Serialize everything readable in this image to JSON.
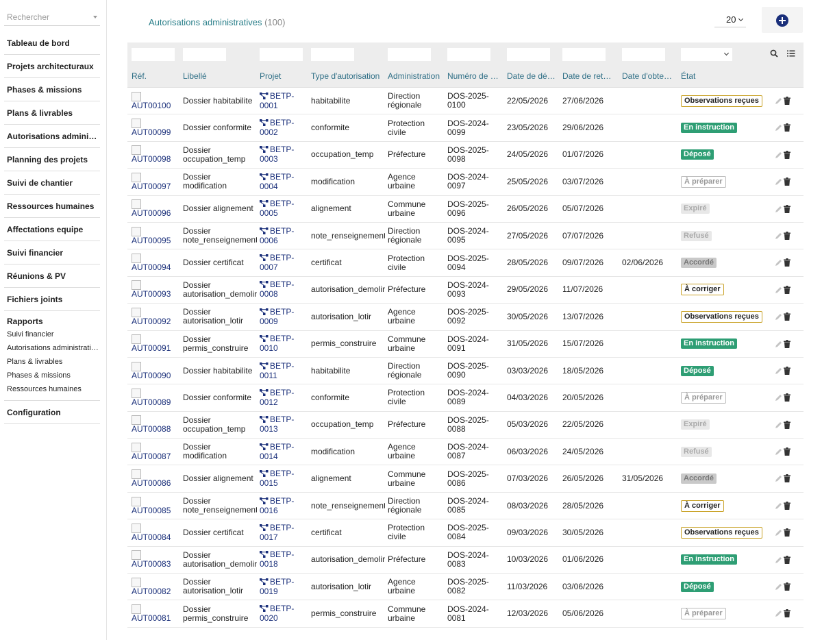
{
  "sidebar": {
    "search_placeholder": "Rechercher",
    "items": [
      {
        "label": "Tableau de bord"
      },
      {
        "label": "Projets architecturaux"
      },
      {
        "label": "Phases & missions"
      },
      {
        "label": "Plans & livrables"
      },
      {
        "label": "Autorisations administratives"
      },
      {
        "label": "Planning des projets"
      },
      {
        "label": "Suivi de chantier"
      },
      {
        "label": "Ressources humaines"
      },
      {
        "label": "Affectations equipe"
      },
      {
        "label": "Suivi financier"
      },
      {
        "label": "Réunions & PV"
      },
      {
        "label": "Fichiers joints"
      }
    ],
    "reports": {
      "title": "Rapports",
      "items": [
        "Suivi financier",
        "Autorisations administratives",
        "Plans & livrables",
        "Phases & missions",
        "Ressources humaines"
      ]
    },
    "config": "Configuration"
  },
  "header": {
    "title": "Autorisations administratives",
    "count": "(100)",
    "page_size": "20"
  },
  "table": {
    "columns": [
      "Réf.",
      "Libellé",
      "Projet",
      "Type d'autorisation",
      "Administration",
      "Numéro de dossier",
      "Date de dépôt",
      "Date de retour prévue",
      "Date d'obtention",
      "État"
    ],
    "rows": [
      {
        "ref": "AUT00100",
        "libelle": "Dossier habitabilite",
        "projet": [
          "BETP-",
          "0001"
        ],
        "type": "habitabilite",
        "admin": [
          "Direction",
          "régionale"
        ],
        "numero": [
          "DOS-2025-",
          "0100"
        ],
        "depot": "22/05/2026",
        "retour": "27/06/2026",
        "obtention": "",
        "etat": "Observations reçues",
        "etat_kind": "observations"
      },
      {
        "ref": "AUT00099",
        "libelle": "Dossier conformite",
        "projet": [
          "BETP-",
          "0002"
        ],
        "type": "conformite",
        "admin": [
          "Protection",
          "civile"
        ],
        "numero": [
          "DOS-2024-",
          "0099"
        ],
        "depot": "23/05/2026",
        "retour": "29/06/2026",
        "obtention": "",
        "etat": "En instruction",
        "etat_kind": "instruction"
      },
      {
        "ref": "AUT00098",
        "libelle": "Dossier occupation_temp",
        "projet": [
          "BETP-",
          "0003"
        ],
        "type": "occupation_temp",
        "admin": [
          "Préfecture",
          ""
        ],
        "numero": [
          "DOS-2025-",
          "0098"
        ],
        "depot": "24/05/2026",
        "retour": "01/07/2026",
        "obtention": "",
        "etat": "Déposé",
        "etat_kind": "depose"
      },
      {
        "ref": "AUT00097",
        "libelle": "Dossier modification",
        "projet": [
          "BETP-",
          "0004"
        ],
        "type": "modification",
        "admin": [
          "Agence",
          "urbaine"
        ],
        "numero": [
          "DOS-2024-",
          "0097"
        ],
        "depot": "25/05/2026",
        "retour": "03/07/2026",
        "obtention": "",
        "etat": "À préparer",
        "etat_kind": "preparer"
      },
      {
        "ref": "AUT00096",
        "libelle": "Dossier alignement",
        "projet": [
          "BETP-",
          "0005"
        ],
        "type": "alignement",
        "admin": [
          "Commune",
          "urbaine"
        ],
        "numero": [
          "DOS-2025-",
          "0096"
        ],
        "depot": "26/05/2026",
        "retour": "05/07/2026",
        "obtention": "",
        "etat": "Expiré",
        "etat_kind": "expire"
      },
      {
        "ref": "AUT00095",
        "libelle": "Dossier note_renseignement",
        "projet": [
          "BETP-",
          "0006"
        ],
        "type": "note_renseignement",
        "admin": [
          "Direction",
          "régionale"
        ],
        "numero": [
          "DOS-2024-",
          "0095"
        ],
        "depot": "27/05/2026",
        "retour": "07/07/2026",
        "obtention": "",
        "etat": "Refusé",
        "etat_kind": "refuse"
      },
      {
        "ref": "AUT00094",
        "libelle": "Dossier certificat",
        "projet": [
          "BETP-",
          "0007"
        ],
        "type": "certificat",
        "admin": [
          "Protection",
          "civile"
        ],
        "numero": [
          "DOS-2025-",
          "0094"
        ],
        "depot": "28/05/2026",
        "retour": "09/07/2026",
        "obtention": "02/06/2026",
        "etat": "Accordé",
        "etat_kind": "accorde"
      },
      {
        "ref": "AUT00093",
        "libelle": "Dossier autorisation_demolir",
        "projet": [
          "BETP-",
          "0008"
        ],
        "type": "autorisation_demolir",
        "admin": [
          "Préfecture",
          ""
        ],
        "numero": [
          "DOS-2024-",
          "0093"
        ],
        "depot": "29/05/2026",
        "retour": "11/07/2026",
        "obtention": "",
        "etat": "À corriger",
        "etat_kind": "corriger"
      },
      {
        "ref": "AUT00092",
        "libelle": "Dossier autorisation_lotir",
        "projet": [
          "BETP-",
          "0009"
        ],
        "type": "autorisation_lotir",
        "admin": [
          "Agence",
          "urbaine"
        ],
        "numero": [
          "DOS-2025-",
          "0092"
        ],
        "depot": "30/05/2026",
        "retour": "13/07/2026",
        "obtention": "",
        "etat": "Observations reçues",
        "etat_kind": "observations"
      },
      {
        "ref": "AUT00091",
        "libelle": "Dossier permis_construire",
        "projet": [
          "BETP-",
          "0010"
        ],
        "type": "permis_construire",
        "admin": [
          "Commune",
          "urbaine"
        ],
        "numero": [
          "DOS-2024-",
          "0091"
        ],
        "depot": "31/05/2026",
        "retour": "15/07/2026",
        "obtention": "",
        "etat": "En instruction",
        "etat_kind": "instruction"
      },
      {
        "ref": "AUT00090",
        "libelle": "Dossier habitabilite",
        "projet": [
          "BETP-",
          "0011"
        ],
        "type": "habitabilite",
        "admin": [
          "Direction",
          "régionale"
        ],
        "numero": [
          "DOS-2025-",
          "0090"
        ],
        "depot": "03/03/2026",
        "retour": "18/05/2026",
        "obtention": "",
        "etat": "Déposé",
        "etat_kind": "depose"
      },
      {
        "ref": "AUT00089",
        "libelle": "Dossier conformite",
        "projet": [
          "BETP-",
          "0012"
        ],
        "type": "conformite",
        "admin": [
          "Protection",
          "civile"
        ],
        "numero": [
          "DOS-2024-",
          "0089"
        ],
        "depot": "04/03/2026",
        "retour": "20/05/2026",
        "obtention": "",
        "etat": "À préparer",
        "etat_kind": "preparer"
      },
      {
        "ref": "AUT00088",
        "libelle": "Dossier occupation_temp",
        "projet": [
          "BETP-",
          "0013"
        ],
        "type": "occupation_temp",
        "admin": [
          "Préfecture",
          ""
        ],
        "numero": [
          "DOS-2025-",
          "0088"
        ],
        "depot": "05/03/2026",
        "retour": "22/05/2026",
        "obtention": "",
        "etat": "Expiré",
        "etat_kind": "expire"
      },
      {
        "ref": "AUT00087",
        "libelle": "Dossier modification",
        "projet": [
          "BETP-",
          "0014"
        ],
        "type": "modification",
        "admin": [
          "Agence",
          "urbaine"
        ],
        "numero": [
          "DOS-2024-",
          "0087"
        ],
        "depot": "06/03/2026",
        "retour": "24/05/2026",
        "obtention": "",
        "etat": "Refusé",
        "etat_kind": "refuse"
      },
      {
        "ref": "AUT00086",
        "libelle": "Dossier alignement",
        "projet": [
          "BETP-",
          "0015"
        ],
        "type": "alignement",
        "admin": [
          "Commune",
          "urbaine"
        ],
        "numero": [
          "DOS-2025-",
          "0086"
        ],
        "depot": "07/03/2026",
        "retour": "26/05/2026",
        "obtention": "31/05/2026",
        "etat": "Accordé",
        "etat_kind": "accorde"
      },
      {
        "ref": "AUT00085",
        "libelle": "Dossier note_renseignement",
        "projet": [
          "BETP-",
          "0016"
        ],
        "type": "note_renseignement",
        "admin": [
          "Direction",
          "régionale"
        ],
        "numero": [
          "DOS-2024-",
          "0085"
        ],
        "depot": "08/03/2026",
        "retour": "28/05/2026",
        "obtention": "",
        "etat": "À corriger",
        "etat_kind": "corriger"
      },
      {
        "ref": "AUT00084",
        "libelle": "Dossier certificat",
        "projet": [
          "BETP-",
          "0017"
        ],
        "type": "certificat",
        "admin": [
          "Protection",
          "civile"
        ],
        "numero": [
          "DOS-2025-",
          "0084"
        ],
        "depot": "09/03/2026",
        "retour": "30/05/2026",
        "obtention": "",
        "etat": "Observations reçues",
        "etat_kind": "observations"
      },
      {
        "ref": "AUT00083",
        "libelle": "Dossier autorisation_demolir",
        "projet": [
          "BETP-",
          "0018"
        ],
        "type": "autorisation_demolir",
        "admin": [
          "Préfecture",
          ""
        ],
        "numero": [
          "DOS-2024-",
          "0083"
        ],
        "depot": "10/03/2026",
        "retour": "01/06/2026",
        "obtention": "",
        "etat": "En instruction",
        "etat_kind": "instruction"
      },
      {
        "ref": "AUT00082",
        "libelle": "Dossier autorisation_lotir",
        "projet": [
          "BETP-",
          "0019"
        ],
        "type": "autorisation_lotir",
        "admin": [
          "Agence",
          "urbaine"
        ],
        "numero": [
          "DOS-2025-",
          "0082"
        ],
        "depot": "11/03/2026",
        "retour": "03/06/2026",
        "obtention": "",
        "etat": "Déposé",
        "etat_kind": "depose"
      },
      {
        "ref": "AUT00081",
        "libelle": "Dossier permis_construire",
        "projet": [
          "BETP-",
          "0020"
        ],
        "type": "permis_construire",
        "admin": [
          "Commune",
          "urbaine"
        ],
        "numero": [
          "DOS-2024-",
          "0081"
        ],
        "depot": "12/03/2026",
        "retour": "05/06/2026",
        "obtention": "",
        "etat": "À préparer",
        "etat_kind": "preparer"
      }
    ]
  },
  "icons": {
    "project": "project-tree-icon",
    "edit": "pencil-icon",
    "delete": "trash-icon",
    "search": "search-icon",
    "list": "list-icon",
    "add": "plus-circle-icon"
  },
  "colors": {
    "accent": "#1a2f7a",
    "title": "#2a7f8a",
    "status_green": "#2e9e74",
    "status_gold": "#c9a227"
  }
}
